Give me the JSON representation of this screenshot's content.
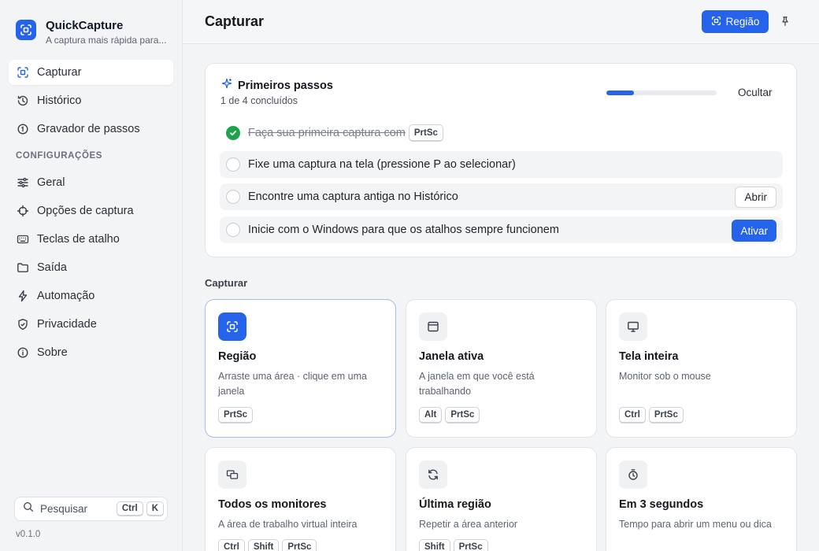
{
  "app": {
    "name": "QuickCapture",
    "tagline": "A captura mais rápida para...",
    "version": "v0.1.0"
  },
  "sidebar": {
    "items": [
      {
        "label": "Capturar",
        "icon": "region-capture-icon",
        "active": true
      },
      {
        "label": "Histórico",
        "icon": "history-icon"
      },
      {
        "label": "Gravador de passos",
        "icon": "step-recorder-icon"
      }
    ],
    "section_title": "CONFIGURAÇÕES",
    "settings_items": [
      {
        "label": "Geral",
        "icon": "sliders-icon"
      },
      {
        "label": "Opções de captura",
        "icon": "crosshair-icon"
      },
      {
        "label": "Teclas de atalho",
        "icon": "keyboard-icon"
      },
      {
        "label": "Saída",
        "icon": "folder-icon"
      },
      {
        "label": "Automação",
        "icon": "lightning-icon"
      },
      {
        "label": "Privacidade",
        "icon": "shield-icon"
      },
      {
        "label": "Sobre",
        "icon": "info-icon"
      }
    ],
    "search": {
      "label": "Pesquisar",
      "keys": [
        "Ctrl",
        "K"
      ]
    }
  },
  "header": {
    "title": "Capturar",
    "region_button": "Região"
  },
  "getting_started": {
    "title": "Primeiros passos",
    "progress_text": "1 de 4 concluídos",
    "progress_fraction": 0.25,
    "hide_label": "Ocultar",
    "steps": [
      {
        "text": "Faça sua primeira captura com",
        "key": "PrtSc",
        "done": true
      },
      {
        "text": "Fixe uma captura na tela (pressione P ao selecionar)",
        "done": false
      },
      {
        "text": "Encontre uma captura antiga no Histórico",
        "done": false,
        "action": "Abrir"
      },
      {
        "text": "Inicie com o Windows para que os atalhos sempre funcionem",
        "done": false,
        "action": "Ativar"
      }
    ]
  },
  "capture": {
    "section_label": "Capturar",
    "modes": [
      {
        "title": "Região",
        "desc": "Arraste uma área · clique em uma janela",
        "keys": [
          "PrtSc"
        ],
        "icon": "region-capture-icon",
        "selected": true
      },
      {
        "title": "Janela ativa",
        "desc": "A janela em que você está trabalhando",
        "keys": [
          "Alt",
          "PrtSc"
        ],
        "icon": "window-icon"
      },
      {
        "title": "Tela inteira",
        "desc": "Monitor sob o mouse",
        "keys": [
          "Ctrl",
          "PrtSc"
        ],
        "icon": "monitor-icon"
      },
      {
        "title": "Todos os monitores",
        "desc": "A área de trabalho virtual inteira",
        "keys": [
          "Ctrl",
          "Shift",
          "PrtSc"
        ],
        "icon": "multi-monitor-icon"
      },
      {
        "title": "Última região",
        "desc": "Repetir a área anterior",
        "keys": [
          "Shift",
          "PrtSc"
        ],
        "icon": "repeat-icon"
      },
      {
        "title": "Em 3 segundos",
        "desc": "Tempo para abrir um menu ou dica",
        "keys": [],
        "icon": "timer-icon"
      }
    ]
  },
  "colors": {
    "accent": "#2563eb",
    "success": "#1fa34a"
  }
}
